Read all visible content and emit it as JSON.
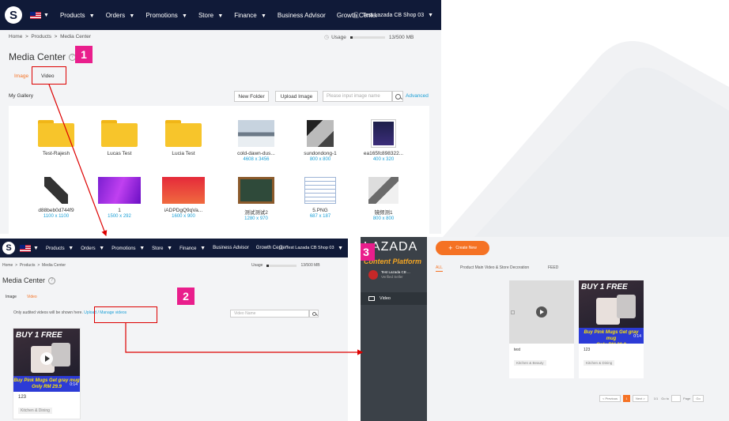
{
  "panel1": {
    "nav": {
      "items": [
        "Products",
        "Orders",
        "Promotions",
        "Store",
        "Finance",
        "Business Advisor",
        "Growth Center"
      ],
      "user": "Test Lazada CB Shop 03"
    },
    "breadcrumb": [
      "Home",
      "Products",
      "Media Center"
    ],
    "usage_label": "Usage",
    "usage_value": "13/500 MB",
    "title": "Media Center",
    "tabs": [
      "Image",
      "Video"
    ],
    "step": "1",
    "gallery_label": "My Gallery",
    "new_folder": "New Folder",
    "upload_image": "Upload Image",
    "search_placeholder": "Please input image name",
    "advanced": "Advanced",
    "items": [
      {
        "name": "Test-Rajesh",
        "size": "",
        "kind": "folder"
      },
      {
        "name": "Lucas Test",
        "size": "",
        "kind": "folder"
      },
      {
        "name": "Lucia Test",
        "size": "",
        "kind": "folder"
      },
      {
        "name": "cold-dawn-dus...",
        "size": "4608 x 3456",
        "kind": "snow"
      },
      {
        "name": "sundondong-1",
        "size": "800 x 800",
        "kind": "phone"
      },
      {
        "name": "ea165fc898322...",
        "size": "400 x 320",
        "kind": "dark"
      },
      {
        "name": "d88beb0d744f9",
        "size": "1100 x 1100",
        "kind": "usb"
      },
      {
        "name": "1",
        "size": "1500 x 292",
        "kind": "purple"
      },
      {
        "name": "iADPDgQ9qVa...",
        "size": "1600 x 900",
        "kind": "red"
      },
      {
        "name": "测试测试2",
        "size": "1280 x 970",
        "kind": "board"
      },
      {
        "name": "5.PNG",
        "size": "687 x 187",
        "kind": "table"
      },
      {
        "name": "镜频测1",
        "size": "800 x 800",
        "kind": "photo"
      }
    ]
  },
  "panel2": {
    "nav": {
      "items": [
        "Products",
        "Orders",
        "Promotions",
        "Store",
        "Finance",
        "Business Advisor",
        "Growth Center"
      ],
      "user": "Test Lazada CB Shop 03"
    },
    "breadcrumb": [
      "Home",
      "Products",
      "Media Center"
    ],
    "usage_label": "Usage",
    "usage_value": "13/500 MB",
    "title": "Media Center",
    "tabs": [
      "Image",
      "Video"
    ],
    "step": "2",
    "notice": "Only audited videos will be shown here.",
    "manage_link": "Upload / Manage videos",
    "search_placeholder": "Video Name",
    "video": {
      "title": "123",
      "tag": "Kitchen & Dining",
      "duration": "0:14",
      "banner_top": "BUY 1 FREE",
      "banner_bottom_1": "Buy Pink Mugs Get gray mug",
      "banner_bottom_2": "Only RM 29.9"
    }
  },
  "panel3": {
    "brand": "LAZADA",
    "brand_sub": "Content Platform",
    "store_name": "Test Lazada CB ...",
    "store_sub": "Verified Seller",
    "menu_video": "Video",
    "step": "3",
    "create_btn": "Create New",
    "tabs": [
      "ALL",
      "Product Main Video & Store Decoration",
      "FEED"
    ],
    "cards": [
      {
        "title": "test",
        "tag": "Kitchen & Beauty"
      },
      {
        "title": "123",
        "tag": "Kitchen & Dining",
        "duration": "0:14"
      }
    ],
    "pager": {
      "prev": "< Previous",
      "page": "1",
      "next": "Next >",
      "total": "1/1",
      "goto": "Go to",
      "page_word": "Page",
      "go": "Go"
    }
  },
  "colors": {
    "accent": "#f57224",
    "nav": "#101a38",
    "step": "#e91e8c",
    "link": "#1a9fd6",
    "annotation": "#d00000"
  }
}
